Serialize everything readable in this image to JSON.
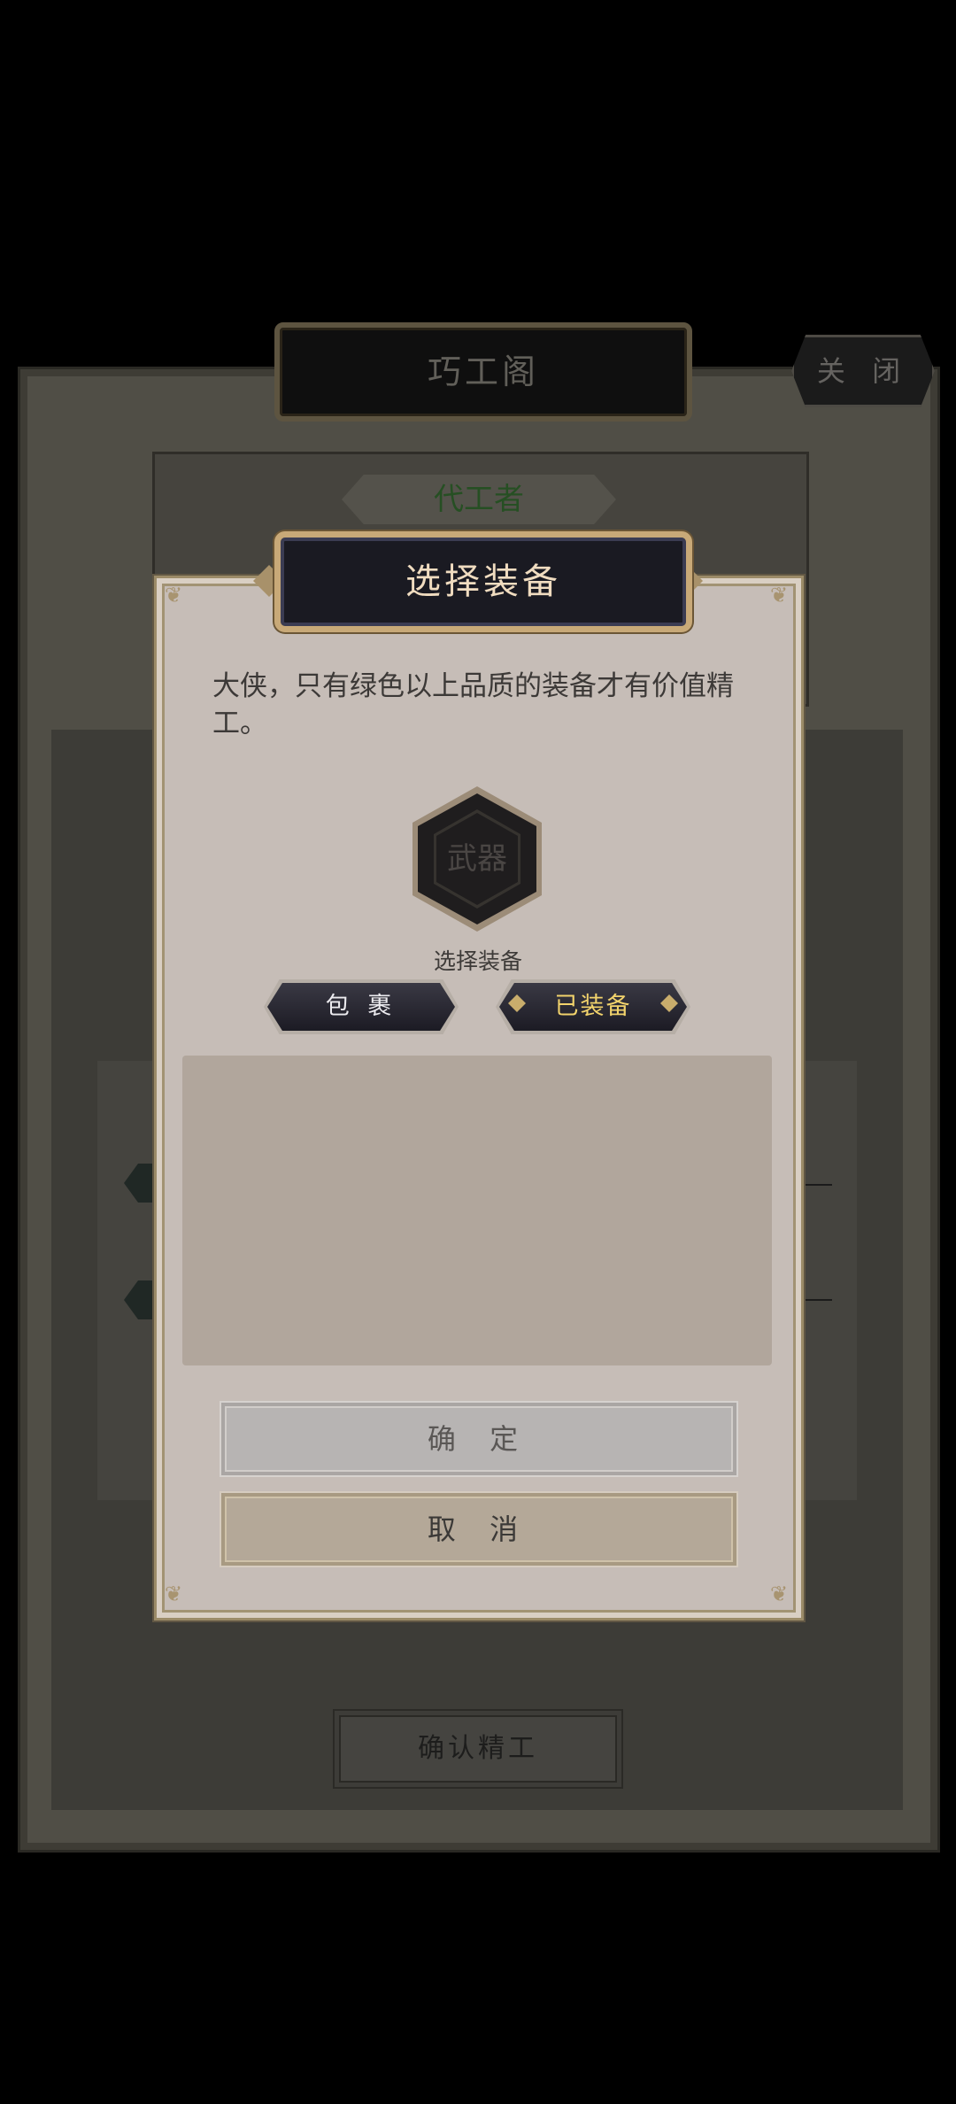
{
  "background": {
    "window_title": "巧工阁",
    "close_button": "关 闭",
    "craftsman_label": "代工者",
    "confirm_refine_button": "确认精工"
  },
  "modal": {
    "title": "选择装备",
    "message": "大侠，只有绿色以上品质的装备才有价值精工。",
    "slot_label": "武器",
    "slot_caption": "选择装备",
    "tabs": [
      {
        "label": "包 裹",
        "selected": false
      },
      {
        "label": "已装备",
        "selected": true
      }
    ],
    "equipment_list": [],
    "confirm_button": "确 定",
    "cancel_button": "取 消"
  },
  "colors": {
    "modal_background": "#c6bdb7",
    "title_bar": "#1a1a22",
    "title_border": "#c8a978",
    "selected_tab_text": "#f2d36c",
    "craftsman_text": "#264f23"
  }
}
